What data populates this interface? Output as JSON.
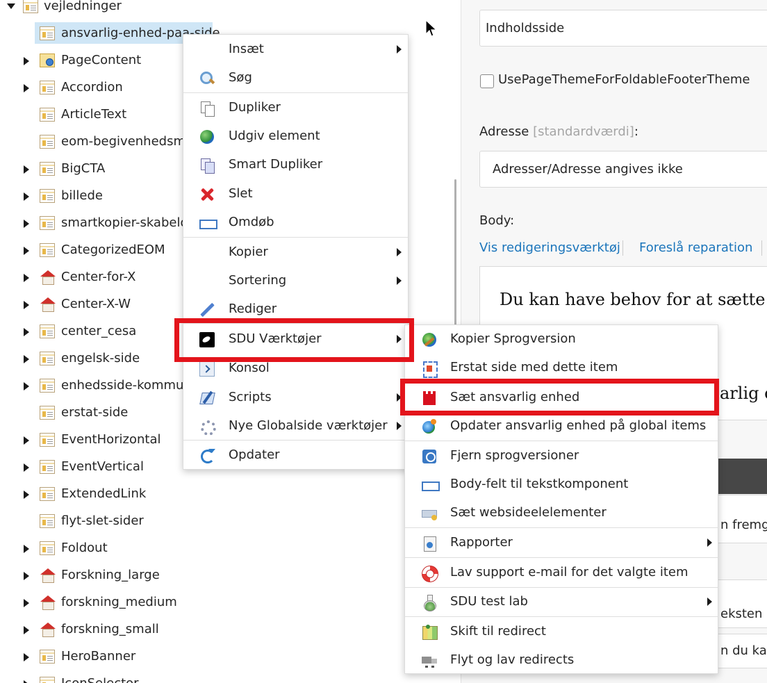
{
  "tree": {
    "items": [
      {
        "label": "vejledninger",
        "icon": "page-icon",
        "expander": "expanded"
      },
      {
        "label": "ansvarlig-enhed-paa-side",
        "icon": "page-icon",
        "expander": "none",
        "selected": true
      },
      {
        "label": "PageContent",
        "icon": "page-content-icon",
        "expander": "collapsed"
      },
      {
        "label": "Accordion",
        "icon": "page-icon",
        "expander": "collapsed"
      },
      {
        "label": "ArticleText",
        "icon": "page-icon",
        "expander": "none"
      },
      {
        "label": "eom-begivenhedsmo",
        "icon": "page-icon",
        "expander": "none"
      },
      {
        "label": "BigCTA",
        "icon": "page-icon",
        "expander": "collapsed"
      },
      {
        "label": "billede",
        "icon": "page-icon",
        "expander": "collapsed"
      },
      {
        "label": "smartkopier-skabelon",
        "icon": "page-icon",
        "expander": "collapsed"
      },
      {
        "label": "CategorizedEOM",
        "icon": "page-icon",
        "expander": "collapsed"
      },
      {
        "label": "Center-for-X",
        "icon": "house-icon",
        "expander": "collapsed"
      },
      {
        "label": "Center-X-W",
        "icon": "house-icon",
        "expander": "collapsed"
      },
      {
        "label": "center_cesa",
        "icon": "page-icon",
        "expander": "collapsed"
      },
      {
        "label": "engelsk-side",
        "icon": "page-icon",
        "expander": "collapsed"
      },
      {
        "label": "enhedsside-kommun",
        "icon": "page-icon",
        "expander": "collapsed"
      },
      {
        "label": "erstat-side",
        "icon": "page-icon",
        "expander": "none"
      },
      {
        "label": "EventHorizontal",
        "icon": "page-icon",
        "expander": "collapsed"
      },
      {
        "label": "EventVertical",
        "icon": "page-icon",
        "expander": "collapsed"
      },
      {
        "label": "ExtendedLink",
        "icon": "page-icon",
        "expander": "collapsed"
      },
      {
        "label": "flyt-slet-sider",
        "icon": "page-icon",
        "expander": "none"
      },
      {
        "label": "Foldout",
        "icon": "page-icon",
        "expander": "collapsed"
      },
      {
        "label": "Forskning_large",
        "icon": "house-icon",
        "expander": "collapsed"
      },
      {
        "label": "forskning_medium",
        "icon": "house-icon",
        "expander": "collapsed"
      },
      {
        "label": "forskning_small",
        "icon": "house-icon",
        "expander": "collapsed"
      },
      {
        "label": "HeroBanner",
        "icon": "page-icon",
        "expander": "collapsed"
      },
      {
        "label": "IconSelector",
        "icon": "page-icon",
        "expander": "collapsed"
      }
    ]
  },
  "form": {
    "title_field_value": "Indholdsside",
    "checkbox_label": "UsePageThemeForFoldableFooterTheme",
    "address_label": "Adresse",
    "address_default": "[standardværdi]",
    "address_colon": ":",
    "address_value": "Adresser/Adresse angives ikke",
    "body_label": "Body:",
    "link_show_editor": "Vis redigeringsværktøj",
    "link_suggest_fix": "Foreslå reparation",
    "body_heading": "Du kan have behov for at sætte eller",
    "body_heading2": "arlig en",
    "partial_text1": "n fremgå",
    "partial_text2": "eksten li",
    "partial_text3": "n du kan"
  },
  "context_menu": {
    "items": [
      {
        "label": "Insæt",
        "icon": "none",
        "submenu": true
      },
      {
        "label": "Søg",
        "icon": "search-icon",
        "submenu": false
      },
      {
        "label": "Dupliker",
        "icon": "duplicate-icon",
        "submenu": false
      },
      {
        "label": "Udgiv element",
        "icon": "publish-globe-icon",
        "submenu": false
      },
      {
        "label": "Smart Dupliker",
        "icon": "smart-duplicate-icon",
        "submenu": false
      },
      {
        "label": "Slet",
        "icon": "delete-icon",
        "submenu": false
      },
      {
        "label": "Omdøb",
        "icon": "rename-icon",
        "submenu": false
      },
      {
        "label": "Kopier",
        "icon": "none",
        "submenu": true
      },
      {
        "label": "Sortering",
        "icon": "none",
        "submenu": true
      },
      {
        "label": "Rediger",
        "icon": "edit-pencil-icon",
        "submenu": false
      },
      {
        "label": "SDU Værktøjer",
        "icon": "sdu-logo-icon",
        "submenu": true,
        "highlighted": true
      },
      {
        "label": "Konsol",
        "icon": "console-icon",
        "submenu": false
      },
      {
        "label": "Scripts",
        "icon": "scripts-icon",
        "submenu": true
      },
      {
        "label": "Nye Globalside værktøjer",
        "icon": "gear-icon",
        "submenu": true
      },
      {
        "label": "Opdater",
        "icon": "refresh-icon",
        "submenu": false
      }
    ]
  },
  "sdu_submenu": {
    "items": [
      {
        "label": "Kopier Sprogversion",
        "icon": "language-copy-icon",
        "submenu": false
      },
      {
        "label": "Erstat side med dette item",
        "icon": "replace-page-icon",
        "submenu": false
      },
      {
        "label": "Sæt ansvarlig enhed",
        "icon": "castle-icon",
        "submenu": false,
        "highlighted": true
      },
      {
        "label": "Opdater ansvarlig enhed på global items",
        "icon": "globe-update-icon",
        "submenu": false
      },
      {
        "label": "Fjern sprogversioner",
        "icon": "remove-language-icon",
        "submenu": false
      },
      {
        "label": "Body-felt til tekstkomponent",
        "icon": "body-field-icon",
        "submenu": false
      },
      {
        "label": "Sæt websideelelementer",
        "icon": "web-elements-icon",
        "submenu": false
      },
      {
        "label": "Rapporter",
        "icon": "report-icon",
        "submenu": true
      },
      {
        "label": "Lav support e-mail for det valgte item",
        "icon": "lifebuoy-icon",
        "submenu": false
      },
      {
        "label": "SDU test lab",
        "icon": "flask-icon",
        "submenu": true
      },
      {
        "label": "Skift til redirect",
        "icon": "map-icon",
        "submenu": false
      },
      {
        "label": "Flyt og lav redirects",
        "icon": "truck-icon",
        "submenu": false
      }
    ]
  },
  "colors": {
    "highlight_red": "#e3141b",
    "link_blue": "#1b75bb",
    "selection_blue": "#cfe6f6"
  }
}
